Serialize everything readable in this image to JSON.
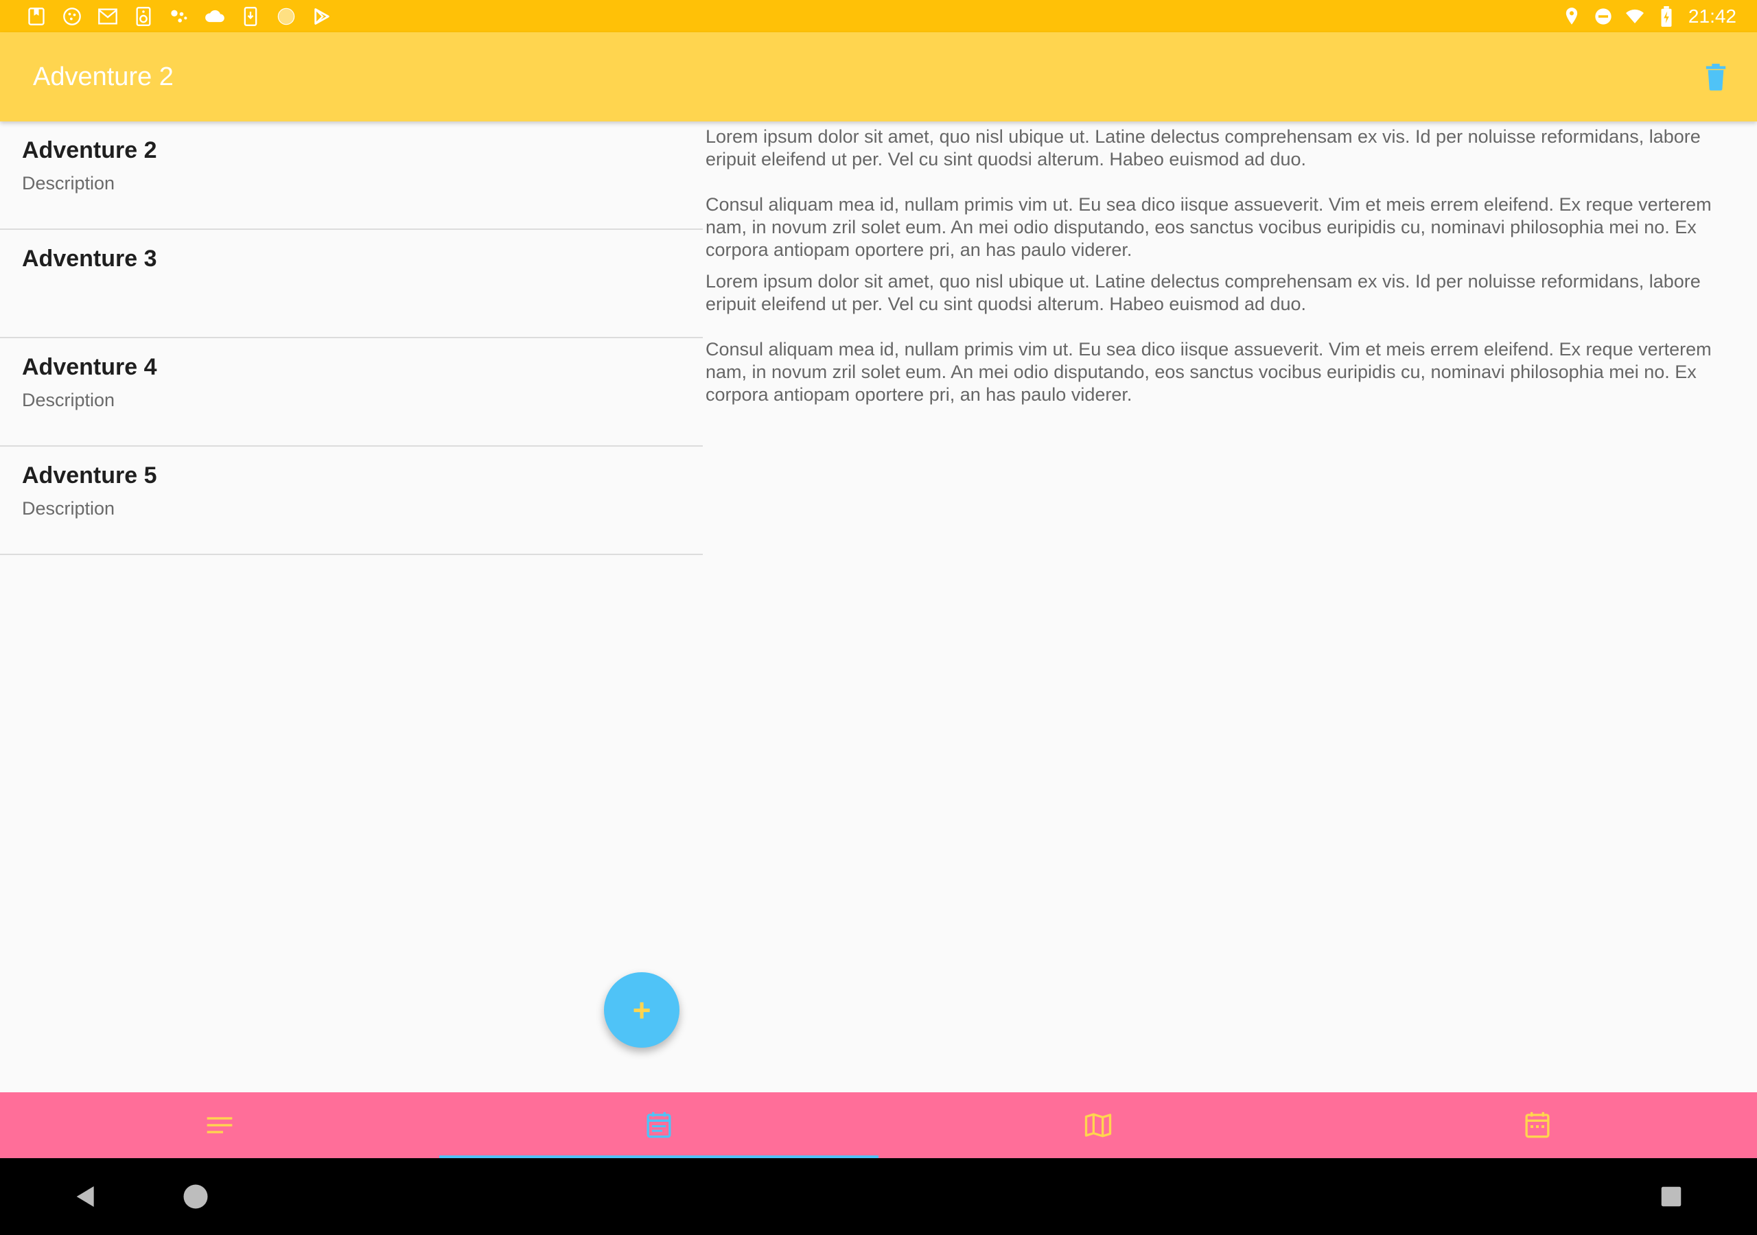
{
  "status_bar": {
    "time": "21:42",
    "left_icons": [
      "bookmark-icon",
      "cookie-icon",
      "gmail-icon",
      "speaker-icon",
      "assistant-icon",
      "cloud-icon",
      "phone-download-icon",
      "circle-icon",
      "play-store-icon"
    ],
    "right_icons": [
      "location-icon",
      "do-not-disturb-icon",
      "wifi-icon",
      "battery-icon"
    ]
  },
  "app_bar": {
    "title": "Adventure 2",
    "delete_icon": "delete-icon"
  },
  "list": {
    "items": [
      {
        "title": "Adventure 2",
        "description": "Description"
      },
      {
        "title": "Adventure 3",
        "description": ""
      },
      {
        "title": "Adventure 4",
        "description": "Description"
      },
      {
        "title": "Adventure 5",
        "description": "Description"
      }
    ]
  },
  "detail": {
    "paragraphs": [
      "Lorem ipsum dolor sit amet, quo nisl ubique ut. Latine delectus comprehensam ex vis. Id per noluisse reformidans, labore eripuit eleifend ut per. Vel cu sint quodsi alterum. Habeo euismod ad duo.",
      "Consul aliquam mea id, nullam primis vim ut. Eu sea dico iisque assueverit. Vim et meis errem eleifend. Ex reque verterem nam, in novum zril solet eum. An mei odio disputando, eos sanctus vocibus euripidis cu, nominavi philosophia mei no. Ex corpora antiopam oportere pri, an has paulo viderer.",
      "Lorem ipsum dolor sit amet, quo nisl ubique ut. Latine delectus comprehensam ex vis. Id per noluisse reformidans, labore eripuit eleifend ut per. Vel cu sint quodsi alterum. Habeo euismod ad duo.",
      "Consul aliquam mea id, nullam primis vim ut. Eu sea dico iisque assueverit. Vim et meis errem eleifend. Ex reque verterem nam, in novum zril solet eum. An mei odio disputando, eos sanctus vocibus euripidis cu, nominavi philosophia mei no. Ex corpora antiopam oportere pri, an has paulo viderer."
    ]
  },
  "fab": {
    "label": "+"
  },
  "bottom_nav": {
    "tabs": [
      {
        "icon": "list-icon",
        "active": false
      },
      {
        "icon": "calendar-list-icon",
        "active": true
      },
      {
        "icon": "map-icon",
        "active": false
      },
      {
        "icon": "calendar-icon",
        "active": false
      }
    ]
  },
  "colors": {
    "status_bar": "#ffc107",
    "app_bar": "#ffd54f",
    "accent": "#4fc3f7",
    "bottom_nav": "#ff6e99",
    "nav_icon": "#ffd54f"
  }
}
